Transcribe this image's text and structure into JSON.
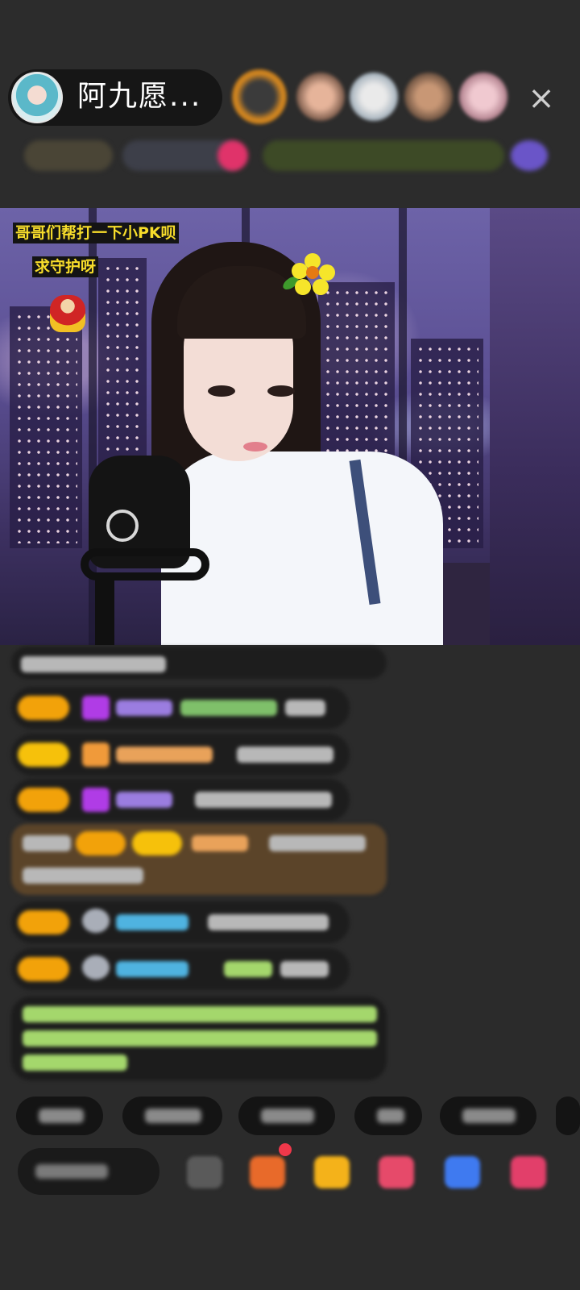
{
  "header": {
    "host_name": "阿九愿...",
    "close_icon": "×"
  },
  "video": {
    "banner_line1": "哥哥们帮打一下小PK呗",
    "banner_line2": "求守护呀",
    "colors": {
      "banner_text": "#f7dd2b",
      "banner_bg": "#141414"
    }
  },
  "icons": [
    "host-avatar",
    "viewer-avatar",
    "close-icon",
    "flower-sticker",
    "lucky-god-icon",
    "emoji-icon",
    "gift-icon",
    "shop-icon",
    "heart-icon",
    "game-icon",
    "more-icon"
  ],
  "colors": {
    "background": "#2b2b2b",
    "level_badge": "#f2a20a",
    "highlight_bubble": "#5b4429"
  }
}
